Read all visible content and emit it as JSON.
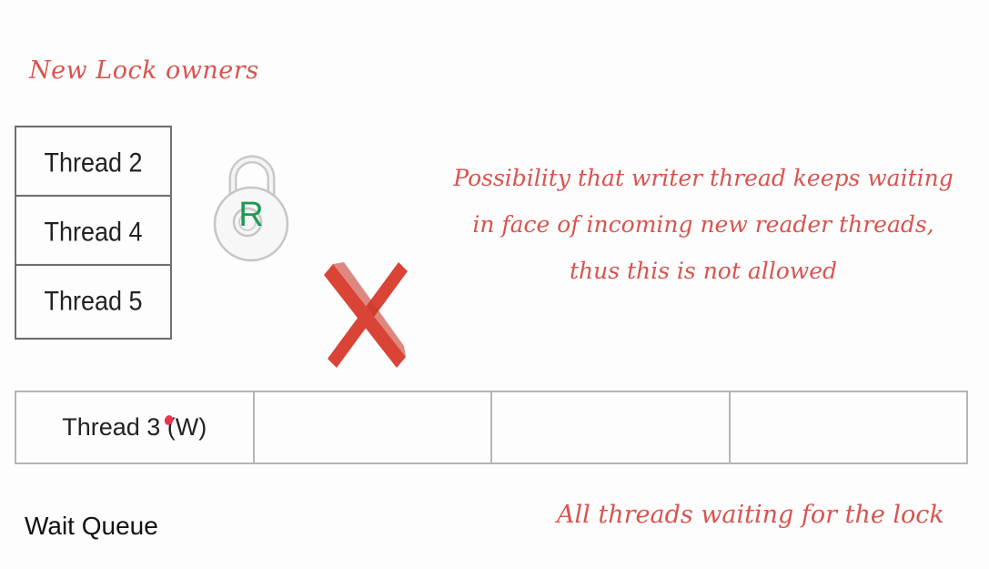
{
  "title": "New Lock owners",
  "lock_owners": [
    "Thread 2",
    "Thread 4",
    "Thread 5"
  ],
  "lock": {
    "mode_letter": "R",
    "letter_color": "#1f9a57"
  },
  "note": "Possibility that writer thread keeps waiting in face of incoming new reader threads, thus this is not allowed",
  "queue": {
    "cells": [
      "Thread 3 (W)",
      "",
      "",
      ""
    ]
  },
  "queue_caption": "All threads waiting for the lock",
  "queue_label": "Wait Queue",
  "colors": {
    "annotation": "#d9534f",
    "cross": "#d94436",
    "border": "#707070"
  }
}
